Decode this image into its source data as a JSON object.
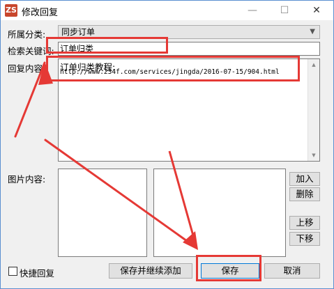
{
  "window": {
    "app_icon_text": "ZS",
    "title": "修改回复",
    "minimize_glyph": "—",
    "maximize_glyph": "☐",
    "close_glyph": "✕"
  },
  "form": {
    "category_label": "所属分类:",
    "category_value": "同步订单",
    "keyword_label": "检索关键词:",
    "keyword_value": "订单归类",
    "reply_label": "回复内容:",
    "reply_line1": "订单归类教程:",
    "reply_line2": "http://www.234f.com/services/jingda/2016-07-15/904.html",
    "image_label": "图片内容:"
  },
  "buttons": {
    "add": "加入",
    "delete": "删除",
    "move_up": "上移",
    "move_down": "下移",
    "save_and_continue": "保存并继续添加",
    "save": "保存",
    "cancel": "取消"
  },
  "quick_reply_label": "快捷回复",
  "colors": {
    "annotation_red": "#e53935",
    "window_border": "#5a8fd0",
    "dialog_bg": "#f0f0f0"
  }
}
